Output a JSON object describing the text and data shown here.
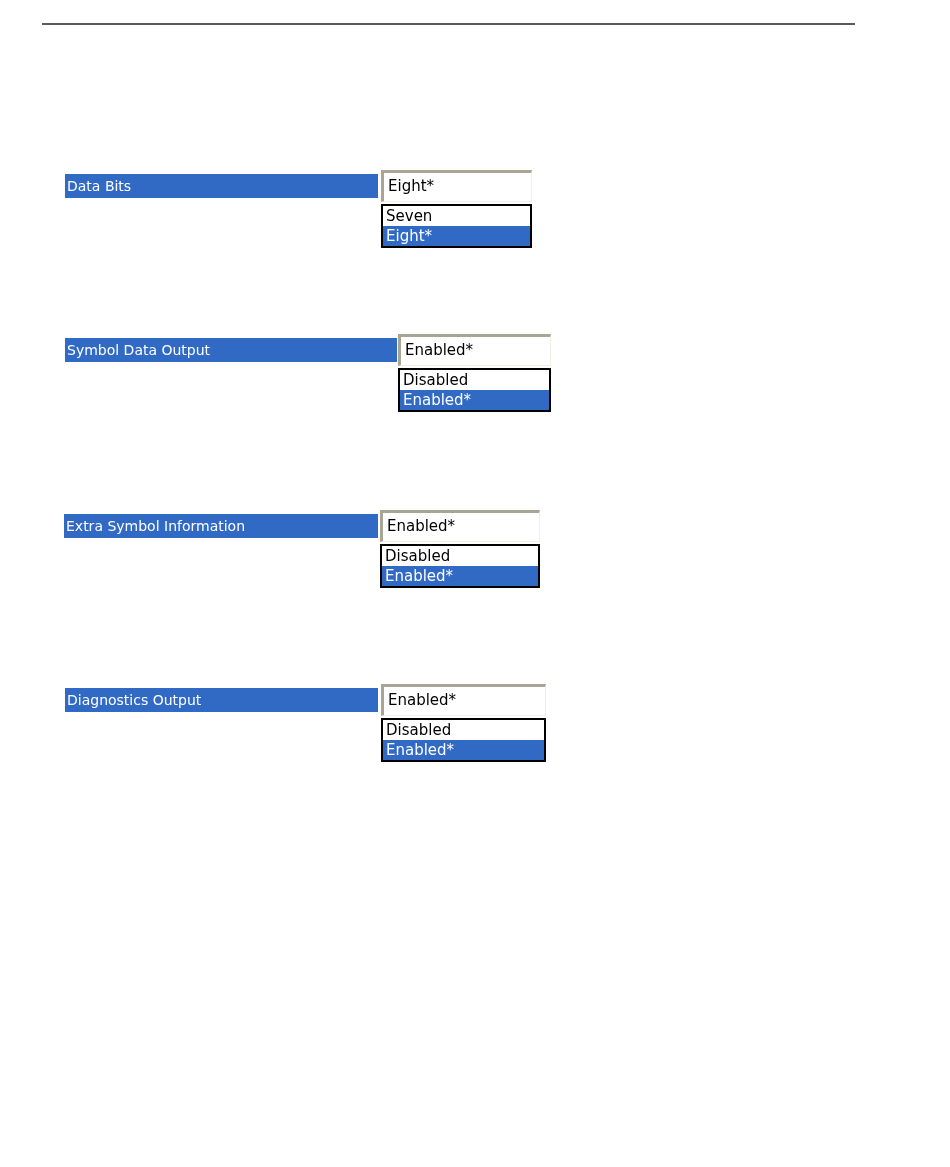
{
  "settings": [
    {
      "label": "Data Bits",
      "value": "Eight*",
      "options": [
        {
          "label": "Seven",
          "selected": false
        },
        {
          "label": "Eight*",
          "selected": true
        }
      ]
    },
    {
      "label": "Symbol Data Output",
      "value": "Enabled*",
      "options": [
        {
          "label": "Disabled",
          "selected": false
        },
        {
          "label": "Enabled*",
          "selected": true
        }
      ]
    },
    {
      "label": "Extra Symbol Information",
      "value": "Enabled*",
      "options": [
        {
          "label": "Disabled",
          "selected": false
        },
        {
          "label": "Enabled*",
          "selected": true
        }
      ]
    },
    {
      "label": "Diagnostics Output",
      "value": "Enabled*",
      "options": [
        {
          "label": "Disabled",
          "selected": false
        },
        {
          "label": "Enabled*",
          "selected": true
        }
      ]
    }
  ]
}
